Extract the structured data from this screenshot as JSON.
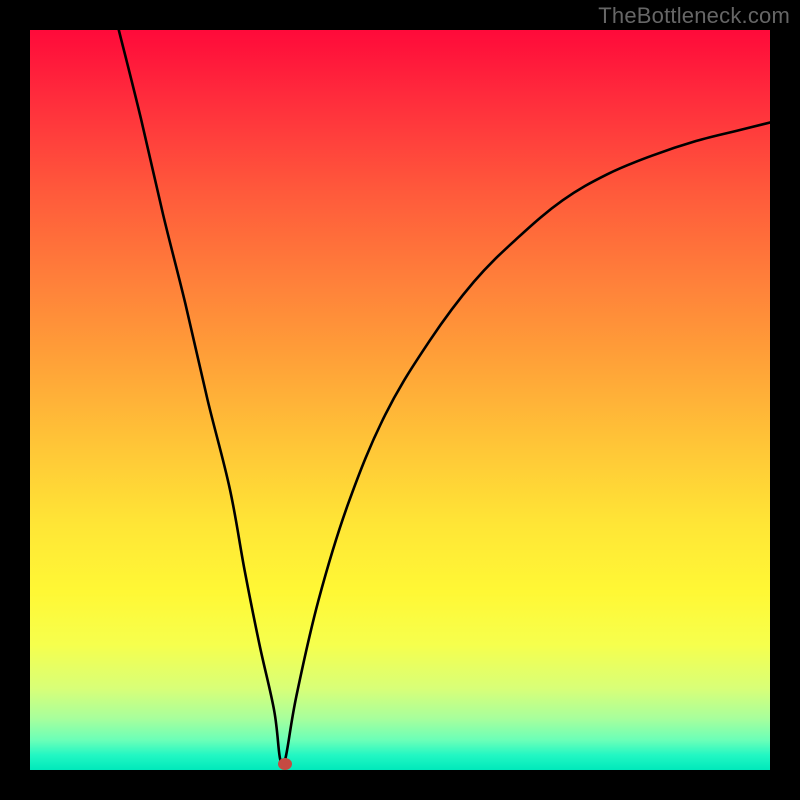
{
  "watermark": "TheBottleneck.com",
  "colors": {
    "border": "#000000",
    "curve": "#000000",
    "dot": "#c54a42"
  },
  "chart_data": {
    "type": "line",
    "title": "",
    "xlabel": "",
    "ylabel": "",
    "xlim": [
      0,
      100
    ],
    "ylim": [
      0,
      100
    ],
    "grid": false,
    "series": [
      {
        "name": "bottleneck-curve",
        "x": [
          12,
          15,
          18,
          21,
          24,
          27,
          29,
          31,
          33,
          33.8,
          34.5,
          36,
          39,
          43,
          48,
          54,
          60,
          66,
          72,
          78,
          84,
          90,
          96,
          100
        ],
        "y": [
          100,
          88,
          75,
          63,
          50,
          38,
          27,
          17,
          8,
          1.5,
          1.5,
          10,
          23,
          36,
          48,
          58,
          66,
          72,
          77,
          80.5,
          83,
          85,
          86.5,
          87.5
        ]
      }
    ],
    "annotations": [
      {
        "name": "minimum-point",
        "x": 34.5,
        "y": 0.8
      }
    ],
    "legend": null
  }
}
